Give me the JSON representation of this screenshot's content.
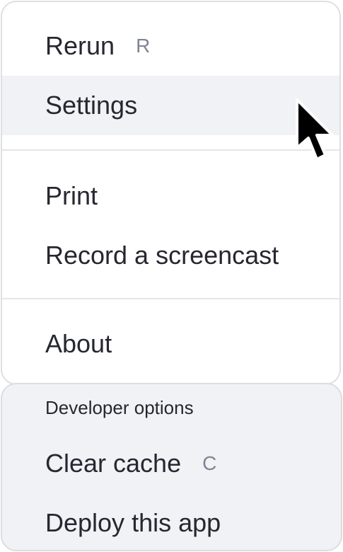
{
  "main_menu": {
    "items": [
      {
        "label": "Rerun",
        "shortcut": "R"
      },
      {
        "label": "Settings"
      },
      {
        "label": "Print"
      },
      {
        "label": "Record a screencast"
      },
      {
        "label": "About"
      }
    ]
  },
  "developer_menu": {
    "header": "Developer options",
    "items": [
      {
        "label": "Clear cache",
        "shortcut": "C"
      },
      {
        "label": "Deploy this app"
      }
    ]
  },
  "colors": {
    "hover_background": "#f0f2f6",
    "text": "#262730",
    "shortcut_text": "#808495",
    "border": "#dfdfe3"
  },
  "icons": {
    "cursor": "mouse-pointer-icon"
  }
}
